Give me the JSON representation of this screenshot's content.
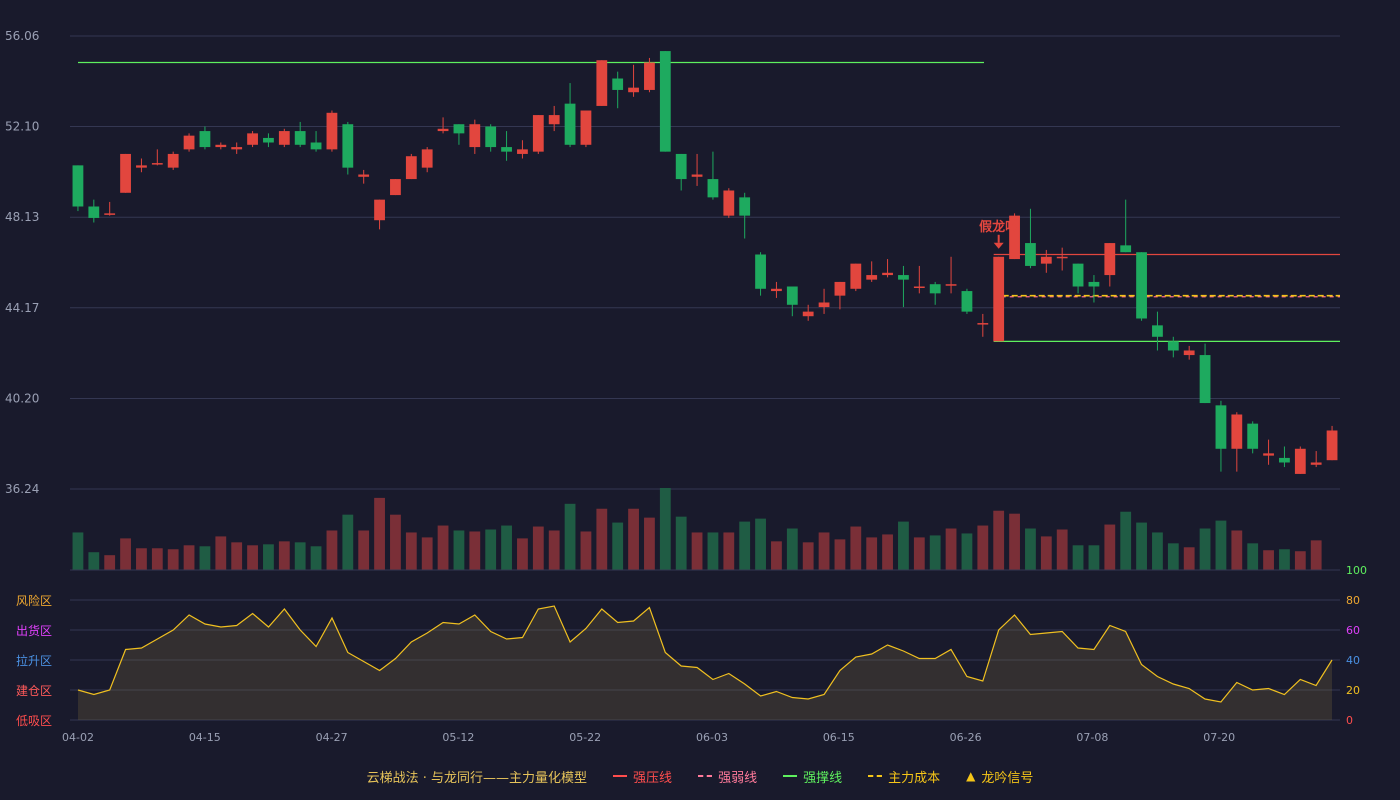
{
  "chart_data": {
    "type": "candlestick",
    "price_axis": {
      "ticks": [
        "56.06",
        "52.10",
        "48.13",
        "44.17",
        "40.20",
        "36.24"
      ],
      "ylim": [
        36.24,
        56.06
      ]
    },
    "oscillator_axis": {
      "ticks": [
        "100",
        "80",
        "60",
        "40",
        "20",
        "0"
      ],
      "ylim": [
        0,
        100
      ]
    },
    "zones": [
      {
        "label": "风险区",
        "color": "#f0a830"
      },
      {
        "label": "出货区",
        "color": "#e040fb"
      },
      {
        "label": "拉升区",
        "color": "#4a90e2"
      },
      {
        "label": "建仓区",
        "color": "#ff5a5a"
      },
      {
        "label": "低吸区",
        "color": "#ff4d4d"
      }
    ],
    "x_labels": [
      {
        "i": 0,
        "label": "04-02"
      },
      {
        "i": 8,
        "label": "04-15"
      },
      {
        "i": 16,
        "label": "04-27"
      },
      {
        "i": 24,
        "label": "05-12"
      },
      {
        "i": 32,
        "label": "05-22"
      },
      {
        "i": 40,
        "label": "06-03"
      },
      {
        "i": 48,
        "label": "06-15"
      },
      {
        "i": 56,
        "label": "06-26"
      },
      {
        "i": 64,
        "label": "07-08"
      },
      {
        "i": 72,
        "label": "07-20"
      }
    ],
    "candles": [
      [
        50.4,
        48.6,
        50.4,
        48.4
      ],
      [
        48.6,
        48.1,
        48.9,
        47.9
      ],
      [
        48.3,
        48.3,
        48.8,
        48.2
      ],
      [
        49.2,
        50.9,
        50.9,
        49.2
      ],
      [
        50.3,
        50.4,
        50.7,
        50.1
      ],
      [
        50.5,
        50.5,
        51.1,
        50.4
      ],
      [
        50.3,
        50.9,
        51.0,
        50.2
      ],
      [
        51.1,
        51.7,
        51.8,
        51.0
      ],
      [
        51.9,
        51.2,
        52.1,
        51.1
      ],
      [
        51.2,
        51.3,
        51.4,
        51.1
      ],
      [
        51.1,
        51.2,
        51.4,
        50.9
      ],
      [
        51.3,
        51.8,
        51.9,
        51.2
      ],
      [
        51.6,
        51.4,
        51.8,
        51.2
      ],
      [
        51.3,
        51.9,
        52.0,
        51.2
      ],
      [
        51.9,
        51.3,
        52.3,
        51.2
      ],
      [
        51.4,
        51.1,
        51.9,
        51.0
      ],
      [
        51.1,
        52.7,
        52.8,
        51.0
      ],
      [
        52.2,
        50.3,
        52.3,
        50.0
      ],
      [
        49.9,
        50.0,
        50.2,
        49.6
      ],
      [
        48.0,
        48.9,
        48.9,
        47.6
      ],
      [
        49.1,
        49.8,
        49.8,
        49.1
      ],
      [
        49.8,
        50.8,
        50.9,
        49.8
      ],
      [
        50.3,
        51.1,
        51.2,
        50.1
      ],
      [
        51.9,
        52.0,
        52.5,
        51.8
      ],
      [
        52.2,
        51.8,
        52.2,
        51.3
      ],
      [
        51.2,
        52.2,
        52.4,
        50.9
      ],
      [
        52.1,
        51.2,
        52.2,
        51.0
      ],
      [
        51.2,
        51.0,
        51.9,
        50.6
      ],
      [
        50.9,
        51.1,
        51.5,
        50.7
      ],
      [
        51.0,
        52.6,
        52.6,
        50.9
      ],
      [
        52.2,
        52.6,
        53.0,
        51.9
      ],
      [
        53.1,
        51.3,
        54.0,
        51.2
      ],
      [
        51.3,
        52.8,
        52.8,
        51.2
      ],
      [
        53.0,
        55.0,
        55.0,
        53.0
      ],
      [
        54.2,
        53.7,
        54.5,
        52.9
      ],
      [
        53.6,
        53.8,
        54.8,
        53.4
      ],
      [
        53.7,
        54.9,
        55.1,
        53.6
      ],
      [
        55.4,
        51.0,
        55.4,
        51.0
      ],
      [
        50.9,
        49.8,
        50.9,
        49.3
      ],
      [
        49.9,
        50.0,
        50.9,
        49.5
      ],
      [
        49.8,
        49.0,
        51.0,
        48.9
      ],
      [
        48.2,
        49.3,
        49.4,
        48.1
      ],
      [
        49.0,
        48.2,
        49.2,
        47.2
      ],
      [
        46.5,
        45.0,
        46.6,
        44.7
      ],
      [
        44.9,
        45.0,
        45.3,
        44.6
      ],
      [
        45.1,
        44.3,
        45.1,
        43.8
      ],
      [
        43.8,
        44.0,
        44.3,
        43.6
      ],
      [
        44.2,
        44.4,
        45.0,
        43.9
      ],
      [
        44.7,
        45.3,
        45.3,
        44.1
      ],
      [
        45.0,
        46.1,
        46.1,
        44.9
      ],
      [
        45.4,
        45.6,
        46.2,
        45.3
      ],
      [
        45.6,
        45.7,
        46.3,
        45.5
      ],
      [
        45.6,
        45.4,
        46.0,
        44.2
      ],
      [
        45.1,
        45.1,
        46.0,
        44.8
      ],
      [
        45.2,
        44.8,
        45.3,
        44.3
      ],
      [
        45.2,
        45.2,
        46.4,
        44.8
      ],
      [
        44.9,
        44.0,
        45.0,
        43.9
      ],
      [
        43.5,
        43.5,
        43.9,
        42.9
      ],
      [
        42.7,
        46.4,
        46.4,
        42.7
      ],
      [
        46.3,
        48.2,
        48.3,
        46.3
      ],
      [
        47.0,
        46.0,
        48.5,
        45.9
      ],
      [
        46.1,
        46.4,
        46.7,
        45.7
      ],
      [
        46.4,
        46.4,
        46.8,
        45.8
      ],
      [
        46.1,
        45.1,
        46.1,
        44.8
      ],
      [
        45.3,
        45.1,
        45.6,
        44.4
      ],
      [
        45.6,
        47.0,
        47.0,
        45.1
      ],
      [
        46.9,
        46.6,
        48.9,
        46.6
      ],
      [
        46.6,
        43.7,
        46.6,
        43.6
      ],
      [
        43.4,
        42.9,
        44.0,
        42.3
      ],
      [
        42.7,
        42.3,
        42.9,
        42.0
      ],
      [
        42.1,
        42.3,
        42.5,
        41.9
      ],
      [
        42.1,
        40.0,
        42.6,
        40.0
      ],
      [
        39.9,
        38.0,
        40.1,
        37.0
      ],
      [
        38.0,
        39.5,
        39.6,
        37.0
      ],
      [
        39.1,
        38.0,
        39.2,
        37.8
      ],
      [
        37.7,
        37.8,
        38.4,
        37.3
      ],
      [
        37.6,
        37.4,
        38.1,
        37.2
      ],
      [
        36.9,
        38.0,
        38.1,
        36.9
      ],
      [
        37.3,
        37.4,
        37.9,
        37.2
      ],
      [
        37.5,
        38.8,
        39.0,
        37.5
      ]
    ],
    "volume": [
      38,
      18,
      15,
      32,
      22,
      22,
      21,
      25,
      24,
      34,
      28,
      25,
      26,
      29,
      28,
      24,
      40,
      56,
      40,
      73,
      56,
      38,
      33,
      45,
      40,
      39,
      41,
      45,
      32,
      44,
      40,
      67,
      39,
      62,
      48,
      62,
      53,
      83,
      54,
      38,
      38,
      38,
      49,
      52,
      29,
      42,
      28,
      38,
      31,
      44,
      33,
      36,
      49,
      33,
      35,
      42,
      37,
      45,
      60,
      57,
      42,
      34,
      41,
      25,
      25,
      46,
      59,
      48,
      38,
      27,
      23,
      42,
      50,
      40,
      27,
      20,
      21,
      19,
      30
    ],
    "oscillator": [
      20,
      17,
      20,
      47,
      48,
      54,
      60,
      70,
      64,
      62,
      63,
      71,
      62,
      74,
      60,
      49,
      68,
      45,
      39,
      33,
      41,
      52,
      58,
      65,
      64,
      70,
      59,
      54,
      55,
      74,
      76,
      52,
      61,
      74,
      65,
      66,
      75,
      45,
      36,
      35,
      27,
      31,
      24,
      16,
      19,
      15,
      14,
      17,
      33,
      42,
      44,
      50,
      46,
      41,
      41,
      47,
      29,
      26,
      60,
      70,
      57,
      58,
      59,
      48,
      47,
      63,
      59,
      37,
      29,
      24,
      21,
      14,
      12,
      25,
      20,
      21,
      17,
      27,
      23,
      40
    ],
    "lines": {
      "resistance_top": 54.9,
      "strong_pressure": 46.5,
      "weak_line": 44.65,
      "main_cost": 44.7,
      "support": 42.7
    },
    "annotation": {
      "text": "假龙吟",
      "index": 58
    },
    "colors": {
      "up": "#e2463e",
      "down": "#1eaa5f",
      "vol_up": "#7a2f37",
      "vol_down": "#1f5c44",
      "pressure": "#e2463e",
      "weak": "#ff6b8a",
      "support": "#5ef05e",
      "cost": "#f5c518",
      "osc": "#f0c020"
    }
  },
  "legend": {
    "title": "云梯战法 · 与龙同行——主力量化模型",
    "items": [
      {
        "label": "强压线",
        "color": "#ff4d4d",
        "kind": "line"
      },
      {
        "label": "强弱线",
        "color": "#ff7a9a",
        "kind": "dash"
      },
      {
        "label": "强撑线",
        "color": "#5ef05e",
        "kind": "line"
      },
      {
        "label": "主力成本",
        "color": "#f5c518",
        "kind": "dash"
      },
      {
        "label": "龙吟信号",
        "color": "#f5c518",
        "kind": "tri"
      }
    ]
  }
}
